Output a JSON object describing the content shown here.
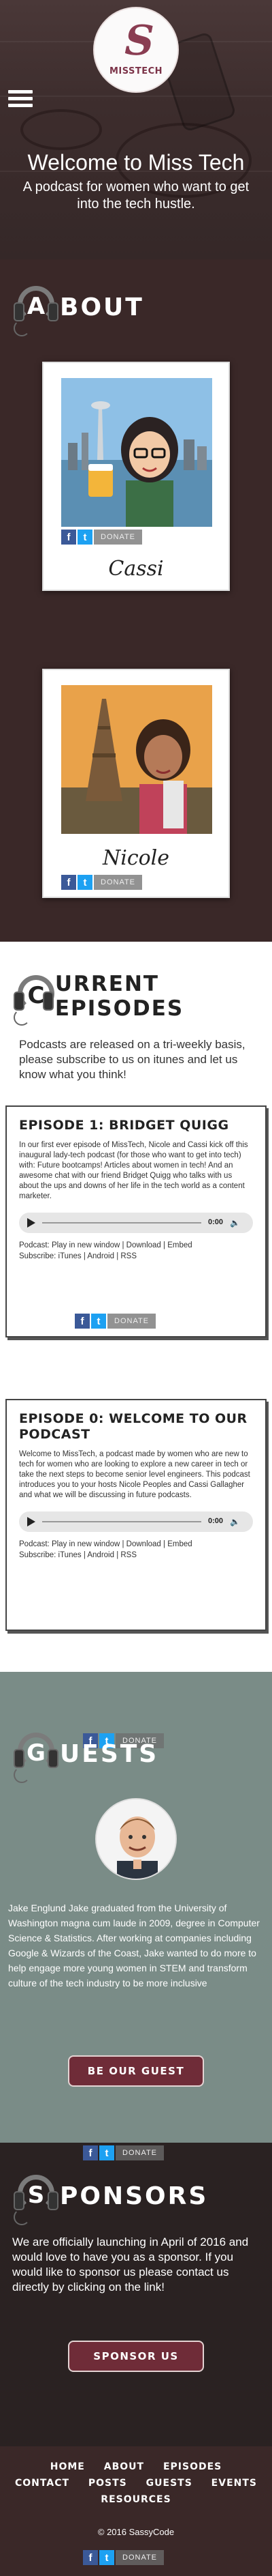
{
  "brand": {
    "logo_text": "MISSTECH"
  },
  "hero": {
    "title": "Welcome to Miss Tech",
    "subtitle": "A podcast for women who want to get into the tech hustle."
  },
  "about": {
    "heading_letter": "A",
    "heading_rest": "BOUT",
    "hosts": [
      {
        "name": "Cassi"
      },
      {
        "name": "Nicole"
      }
    ]
  },
  "share": {
    "fb": "f",
    "tw": "t",
    "donate": "DONATE"
  },
  "episodes": {
    "heading_letter": "C",
    "heading_rest": "URRENT EPISODES",
    "intro": "Podcasts are released on a tri-weekly basis, please subscribe to us on itunes and let us know what you think!",
    "items": [
      {
        "title": "EPISODE 1: BRIDGET QUIGG",
        "description": "In our first ever episode of MissTech, Nicole and Cassi kick off this inaugural lady-tech podcast (for those who want to get into tech) with: Future bootcamps! Articles about women in tech! And an awesome chat with our friend Bridget Quigg who talks with us about the ups and downs of her life in the tech world as a content marketer.",
        "time": "0:00",
        "podcast_line": "Podcast: Play in new window | Download | Embed",
        "subscribe_line": "Subscribe: iTunes | Android | RSS"
      },
      {
        "title": "EPISODE 0: WELCOME TO OUR PODCAST",
        "description": "Welcome to MissTech, a podcast made by women who are new to tech for women who are looking to explore a new career in tech or take the next steps to become senior level engineers. This podcast introduces you to your hosts Nicole Peoples and Cassi Gallagher and what we will be discussing in future podcasts.",
        "time": "0:00",
        "podcast_line": "Podcast: Play in new window | Download | Embed",
        "subscribe_line": "Subscribe: iTunes | Android | RSS"
      }
    ]
  },
  "guests": {
    "heading_letter": "G",
    "heading_rest": "UESTS",
    "bio": "Jake Englund Jake graduated from the University of Washington magna cum laude in 2009, degree in Computer Science & Statistics. After working at companies including Google & Wizards of the Coast, Jake wanted to do more to help engage more young women in STEM and transform culture of the tech industry to be more inclusive",
    "cta": "BE OUR GUEST"
  },
  "sponsors": {
    "heading_letter": "S",
    "heading_rest": "PONSORS",
    "text": "We are officially launching in April of 2016 and would love to have you as a sponsor. If you would like to sponsor us please contact us directly by clicking on the link!",
    "cta": "SPONSOR US"
  },
  "footer": {
    "nav": [
      "HOME",
      "ABOUT",
      "EPISODES",
      "CONTACT",
      "POSTS",
      "GUESTS",
      "EVENTS",
      "RESOURCES"
    ],
    "copyright": "© 2016 SassyCode"
  }
}
